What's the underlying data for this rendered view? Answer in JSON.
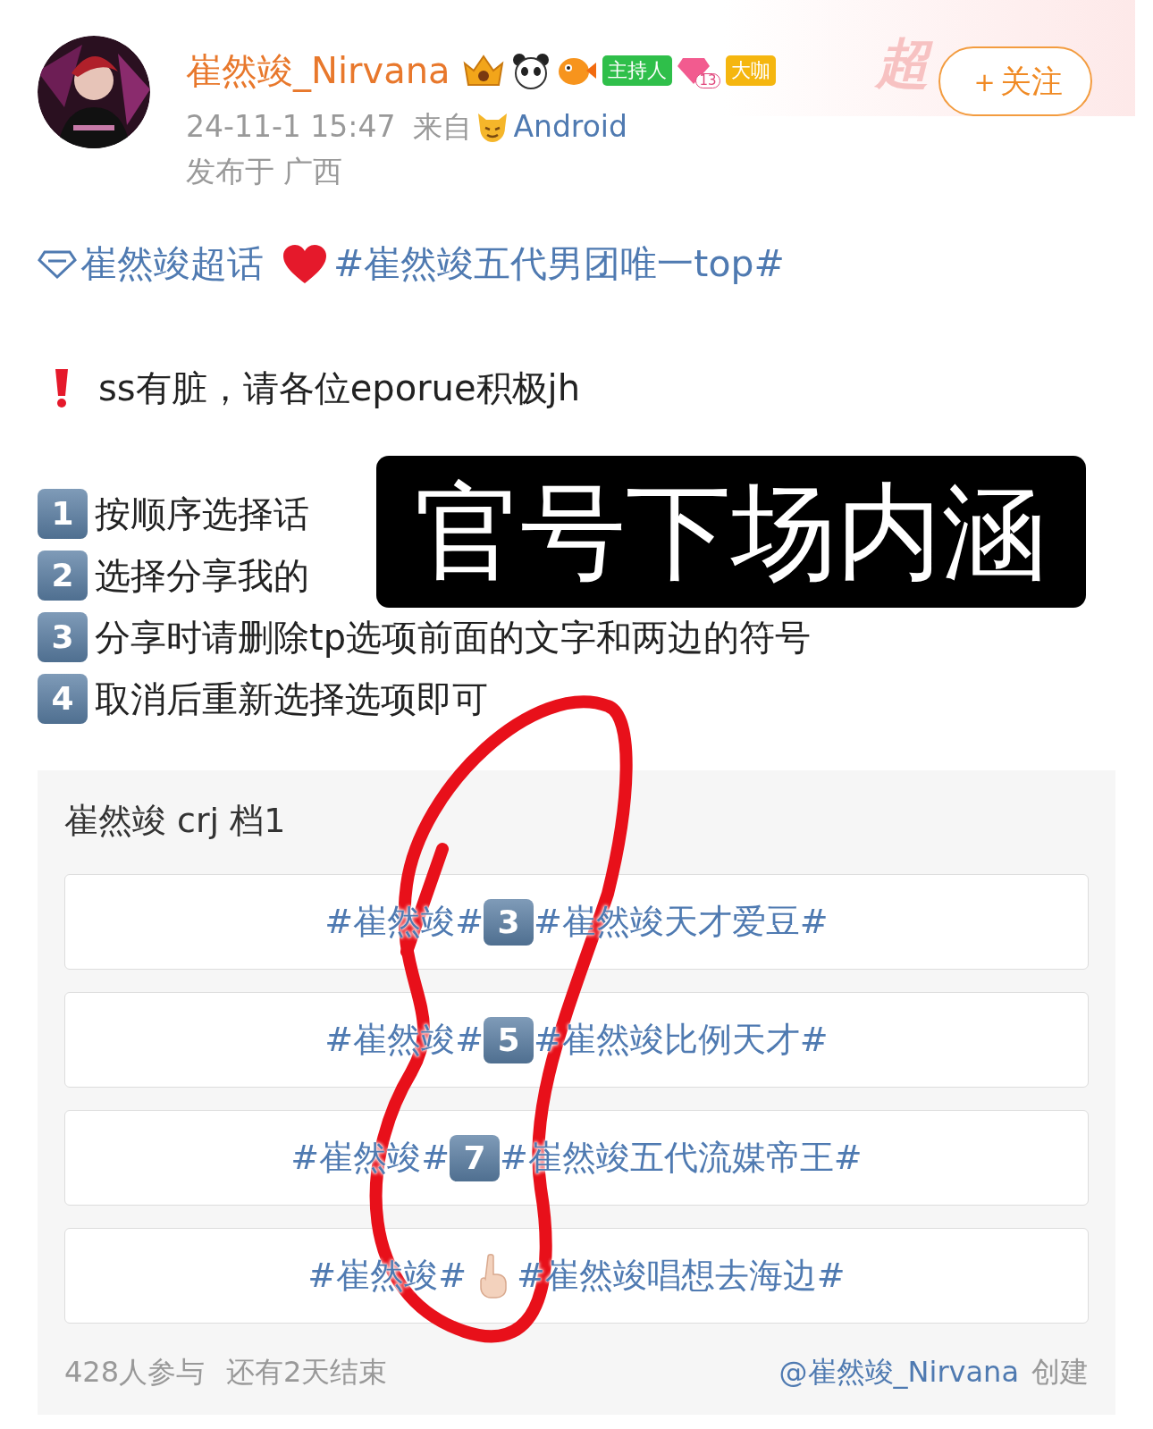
{
  "header": {
    "name": "崔然竣_Nirvana",
    "badges": [
      {
        "kind": "crown"
      },
      {
        "kind": "panda"
      },
      {
        "kind": "fish"
      },
      {
        "kind": "tag",
        "text": "主持人",
        "color": "#2fbf4a"
      },
      {
        "kind": "gem",
        "text": "13"
      },
      {
        "kind": "tag",
        "text": "大咖",
        "color": "#f5b60f"
      }
    ],
    "time": "24-11-1 15:47",
    "via_label": "来自",
    "source": "Android",
    "location": "发布于 广西",
    "watermark": "超",
    "follow_button": "＋关注"
  },
  "topic_line": {
    "super_topic": "崔然竣超话",
    "hashtag": "#崔然竣五代男团唯一top#"
  },
  "notice": "ss有脏，请各位eporue积极jh",
  "steps": [
    {
      "number": "1",
      "text": "按顺序选择话"
    },
    {
      "number": "2",
      "text": "选择分享我的"
    },
    {
      "number": "3",
      "text": "分享时请删除tp选项前面的文字和两边的符号"
    },
    {
      "number": "4",
      "text": "取消后重新选择选项即可"
    }
  ],
  "overlay_caption": "官号下场内涵",
  "poll": {
    "title": "崔然竣 crj 档1",
    "options": [
      {
        "before": "#崔然竣#",
        "mark": {
          "kind": "keycap",
          "text": "3"
        },
        "after": "#崔然竣天才爱豆#"
      },
      {
        "before": "#崔然竣#",
        "mark": {
          "kind": "keycap",
          "text": "5"
        },
        "after": "#崔然竣比例天才#"
      },
      {
        "before": "#崔然竣#",
        "mark": {
          "kind": "keycap",
          "text": "7"
        },
        "after": "#崔然竣五代流媒帝王#"
      },
      {
        "before": "#崔然竣#",
        "mark": {
          "kind": "finger"
        },
        "after": "#崔然竣唱想去海边#"
      }
    ],
    "participants": "428人参与",
    "remaining": "还有2天结束",
    "creator": "@崔然竣_Nirvana",
    "created_label": "创建"
  }
}
